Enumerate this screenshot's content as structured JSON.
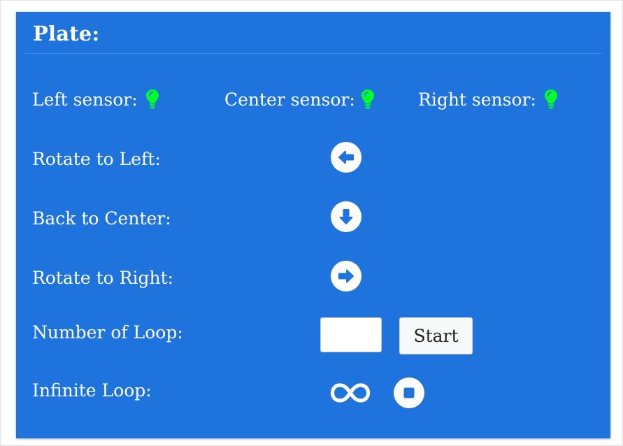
{
  "panel": {
    "title": "Plate:"
  },
  "sensors": [
    {
      "label": "Left sensor:",
      "icon": "lightbulb-icon",
      "color": "#00ff2a"
    },
    {
      "label": "Center sensor:",
      "icon": "lightbulb-icon",
      "color": "#00ff2a"
    },
    {
      "label": "Right sensor:",
      "icon": "lightbulb-icon",
      "color": "#00ff2a"
    }
  ],
  "controls": {
    "rotate_left": {
      "label": "Rotate to Left:",
      "icon": "arrow-left-circle-icon"
    },
    "back_center": {
      "label": "Back to Center:",
      "icon": "arrow-down-circle-icon"
    },
    "rotate_right": {
      "label": "Rotate to Right:",
      "icon": "arrow-right-circle-icon"
    },
    "loop": {
      "label": "Number of Loop:",
      "input_value": "",
      "start_label": "Start"
    },
    "infinite": {
      "label": "Infinite Loop:",
      "infinity_icon": "infinity-icon",
      "stop_icon": "stop-circle-icon"
    }
  },
  "colors": {
    "panel_background": "#1e74dc",
    "sensor_on": "#00ff2a",
    "icon_foreground": "#1e74dc",
    "button_background": "#ffffff"
  }
}
